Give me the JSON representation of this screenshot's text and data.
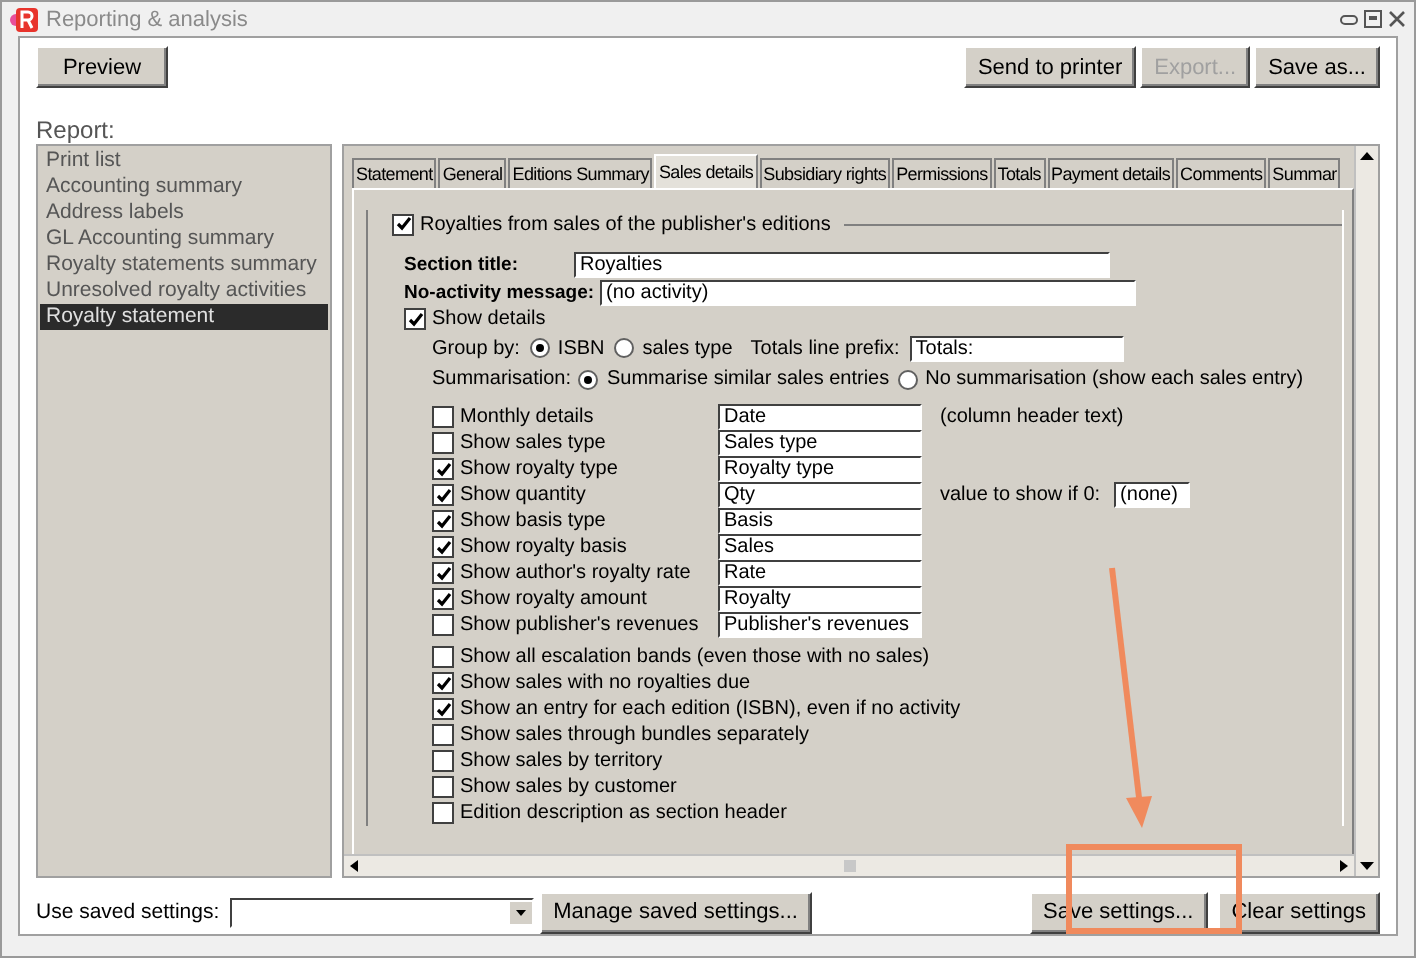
{
  "window": {
    "title": "Reporting & analysis"
  },
  "toolbar": {
    "preview": "Preview",
    "buttons": [
      {
        "label": "Send to printer",
        "disabled": false
      },
      {
        "label": "Export...",
        "disabled": true
      },
      {
        "label": "Save as...",
        "disabled": false
      }
    ]
  },
  "report": {
    "label": "Report:",
    "items": [
      {
        "label": "Print list",
        "selected": false
      },
      {
        "label": "Accounting summary",
        "selected": false
      },
      {
        "label": "Address labels",
        "selected": false
      },
      {
        "label": "GL Accounting summary",
        "selected": false
      },
      {
        "label": "Royalty statements summary",
        "selected": false
      },
      {
        "label": "Unresolved royalty activities",
        "selected": false
      },
      {
        "label": "Royalty statement",
        "selected": true
      }
    ]
  },
  "tabs": [
    {
      "label": "Statement",
      "selected": false
    },
    {
      "label": "General",
      "selected": false
    },
    {
      "label": "Editions Summary",
      "selected": false
    },
    {
      "label": "Sales details",
      "selected": true
    },
    {
      "label": "Subsidiary rights",
      "selected": false
    },
    {
      "label": "Permissions",
      "selected": false
    },
    {
      "label": "Totals",
      "selected": false
    },
    {
      "label": "Payment details",
      "selected": false
    },
    {
      "label": "Comments",
      "selected": false
    },
    {
      "label": "Summar",
      "selected": false
    }
  ],
  "section": {
    "label": "Royalties from sales of the publisher's editions",
    "checked": true,
    "fields": [
      {
        "label": "Section title:",
        "value": "Royalties"
      },
      {
        "label": "No-activity message:",
        "value": "(no activity)"
      }
    ],
    "show_details": {
      "label": "Show details",
      "checked": true
    },
    "group_by": {
      "label": "Group by:",
      "options": [
        {
          "label": "ISBN",
          "selected": true
        },
        {
          "label": "sales type",
          "selected": false
        }
      ]
    },
    "totals_prefix": {
      "label": "Totals line prefix:",
      "value": "Totals:"
    },
    "summarisation": {
      "label": "Summarisation:",
      "options": [
        {
          "label": "Summarise similar sales entries",
          "selected": true
        },
        {
          "label": "No summarisation (show each sales entry)",
          "selected": false
        }
      ]
    },
    "columns": [
      {
        "label": "Monthly details",
        "checked": false,
        "value": "Date",
        "extra": {
          "kind": "note",
          "text": "(column header text)"
        }
      },
      {
        "label": "Show sales type",
        "checked": false,
        "value": "Sales type"
      },
      {
        "label": "Show royalty type",
        "checked": true,
        "value": "Royalty type"
      },
      {
        "label": "Show quantity",
        "checked": true,
        "value": "Qty",
        "extra": {
          "kind": "field",
          "text": "value to show if 0:",
          "value": "(none)"
        }
      },
      {
        "label": "Show basis type",
        "checked": true,
        "value": "Basis"
      },
      {
        "label": "Show royalty basis",
        "checked": true,
        "value": "Sales"
      },
      {
        "label": "Show author's royalty rate",
        "checked": true,
        "value": "Rate"
      },
      {
        "label": "Show royalty amount",
        "checked": true,
        "value": "Royalty"
      },
      {
        "label": "Show publisher's revenues",
        "checked": false,
        "value": "Publisher's revenues"
      }
    ],
    "options": [
      {
        "label": "Show all escalation bands (even those with no sales)",
        "checked": false
      },
      {
        "label": "Show sales with no royalties due",
        "checked": true
      },
      {
        "label": "Show an entry for each edition (ISBN), even if no activity",
        "checked": true
      },
      {
        "label": "Show sales through bundles separately",
        "checked": false
      },
      {
        "label": "Show sales by territory",
        "checked": false
      },
      {
        "label": "Show sales by customer",
        "checked": false
      },
      {
        "label": "Edition description as section header",
        "checked": false
      }
    ]
  },
  "bottom": {
    "saved_label": "Use saved settings:",
    "manage": "Manage saved settings...",
    "save": "Save settings...",
    "clear": "Clear settings"
  }
}
